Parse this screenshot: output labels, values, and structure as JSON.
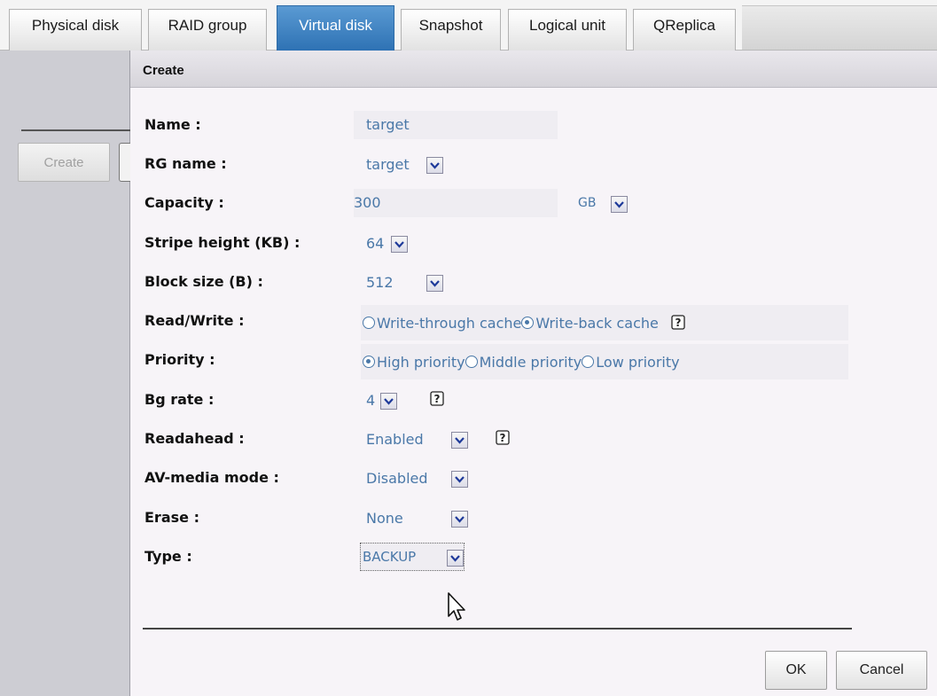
{
  "tabs": [
    {
      "label": "Physical disk",
      "active": false
    },
    {
      "label": "RAID group",
      "active": false
    },
    {
      "label": "Virtual disk",
      "active": true
    },
    {
      "label": "Snapshot",
      "active": false
    },
    {
      "label": "Logical unit",
      "active": false
    },
    {
      "label": "QReplica",
      "active": false
    }
  ],
  "sidebar": {
    "create_label": "Create"
  },
  "dialog": {
    "title": "Create",
    "fields": {
      "name": {
        "label": "Name :",
        "value": "target"
      },
      "rg_name": {
        "label": "RG name :",
        "value": "target"
      },
      "capacity": {
        "label": "Capacity :",
        "value": "300",
        "unit": "GB"
      },
      "stripe_height": {
        "label": "Stripe height (KB) :",
        "value": "64"
      },
      "block_size": {
        "label": "Block size (B) :",
        "value": "512"
      },
      "read_write": {
        "label": "Read/Write :",
        "options": [
          "Write-through cache",
          "Write-back cache"
        ],
        "selected": "Write-back cache"
      },
      "priority": {
        "label": "Priority :",
        "options": [
          "High priority",
          "Middle priority",
          "Low priority"
        ],
        "selected": "High priority"
      },
      "bg_rate": {
        "label": "Bg rate :",
        "value": "4"
      },
      "readahead": {
        "label": "Readahead :",
        "value": "Enabled"
      },
      "av_media_mode": {
        "label": "AV-media mode :",
        "value": "Disabled"
      },
      "erase": {
        "label": "Erase :",
        "value": "None"
      },
      "type": {
        "label": "Type :",
        "value": "BACKUP"
      }
    },
    "ok_label": "OK",
    "cancel_label": "Cancel"
  },
  "colors": {
    "accent_tab": "#2e72b4",
    "field_text": "#4a78a8",
    "sidebar_bg": "#cdcdd3"
  },
  "icons": {
    "dropdown": "chevron-down-icon",
    "help": "help-icon",
    "cursor": "mouse-pointer-icon"
  }
}
